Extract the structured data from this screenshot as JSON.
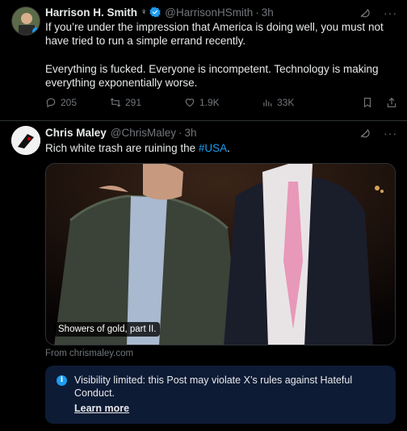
{
  "tweets": [
    {
      "author_name": "Harrison H. Smith",
      "handle": "@HarrisonHSmith",
      "time": "3h",
      "text_p1": "If you’re under the impression that America is doing well, you must not have tried to run a simple errand recently.",
      "text_p2": "Everything is fucked. Everyone is incompetent. Technology is making everything exponentially worse.",
      "stats": {
        "replies": "205",
        "reposts": "291",
        "likes": "1.9K",
        "views": "33K"
      }
    },
    {
      "author_name": "Chris Maley",
      "handle": "@ChrisMaley",
      "time": "3h",
      "text": "Rich white trash are ruining the ",
      "hashtag": "#USA",
      "text_end": ".",
      "image_caption": "Showers of gold, part II.",
      "link_source": "From chrismaley.com",
      "notice": {
        "text": "Visibility limited: this Post may violate X’s rules against Hateful Conduct.",
        "link": "Learn more"
      }
    }
  ],
  "colors": {
    "accent": "#1d9bf0",
    "muted": "#71767b",
    "notice_bg": "#0e1b35"
  }
}
